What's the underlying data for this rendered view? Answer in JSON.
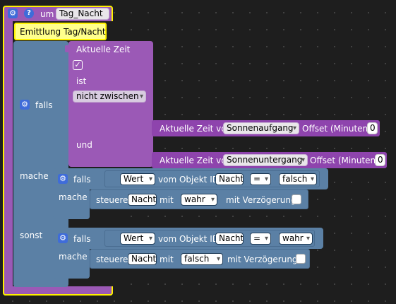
{
  "function_block": {
    "keyword": "um",
    "name": "Tag_Nacht",
    "comment": "Emittlung Tag/Nacht"
  },
  "if_block": {
    "falls": "falls",
    "mache": "mache",
    "sonst": "sonst",
    "und": "und"
  },
  "time_compare": {
    "title": "Aktuelle Zeit",
    "check": "✓",
    "ist": "ist",
    "operator": "nicht zwischen"
  },
  "astro_1": {
    "label": "Aktuelle Zeit von",
    "event": "Sonnenaufgang",
    "offset_label": "Offset (Minuten)",
    "offset_value": "0"
  },
  "astro_2": {
    "label": "Aktuelle Zeit von",
    "event": "Sonnenuntergang",
    "offset_label": "Offset (Minuten)",
    "offset_value": "0"
  },
  "inner_if_1": {
    "falls": "falls",
    "mache": "mache",
    "value_label": "Wert",
    "object_label": "vom Objekt ID",
    "object_id": "Nacht",
    "operator": "=",
    "compare_value": "falsch",
    "set_label": "steuere",
    "set_target": "Nacht",
    "with_label": "mit",
    "set_value": "wahr",
    "delay_label": "mit Verzögerung"
  },
  "inner_if_2": {
    "falls": "falls",
    "mache": "mache",
    "value_label": "Wert",
    "object_label": "vom Objekt ID",
    "object_id": "Nacht",
    "operator": "=",
    "compare_value": "wahr",
    "set_label": "steuere",
    "set_target": "Nacht",
    "with_label": "mit",
    "set_value": "falsch",
    "delay_label": "mit Verzögerung"
  },
  "colors": {
    "function_purple": "#9b59b6",
    "logic_blue": "#5b80a5",
    "highlight_yellow": "#fff200"
  },
  "icons": [
    "gear-icon",
    "help-icon",
    "checkmark-icon"
  ]
}
